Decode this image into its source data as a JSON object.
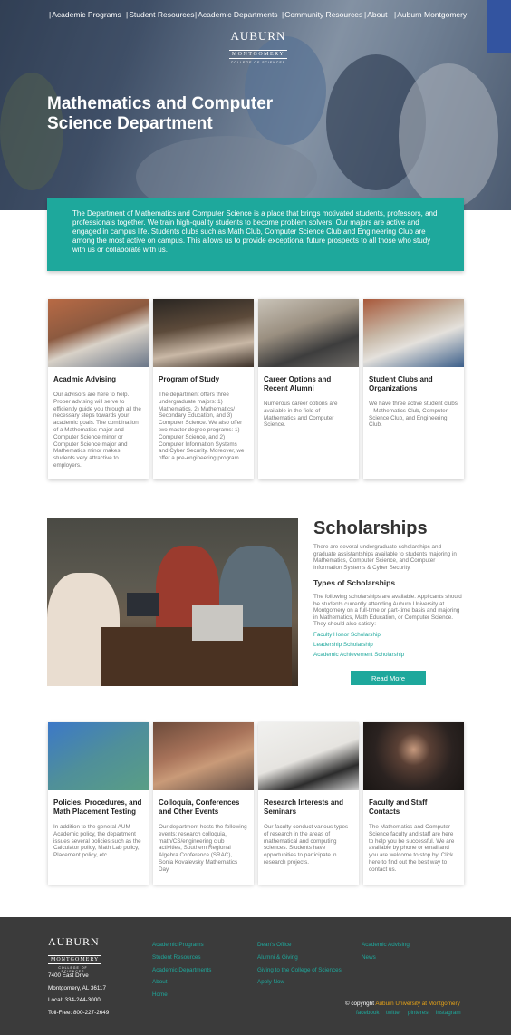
{
  "nav": [
    "Academic Programs",
    "Student Resources",
    "Academic Departments",
    "Community Resources",
    "About",
    "Auburn Montgomery"
  ],
  "logo": {
    "main": "AUBURN",
    "sub": "MONTGOMERY",
    "tag": "COLLEGE OF SCIENCES"
  },
  "hero": {
    "title": "Mathematics and Computer Science Department"
  },
  "intro": "The Department of Mathematics and Computer Science is a place that brings motivated students, professors, and professionals together.  We train high-quality students to become problem solvers.  Our majors are active and engaged in campus life.  Students clubs such as Math Club, Computer Science Club and Engineering Club are among the most active on campus.  This allows us to provide exceptional future prospects to all those who study with us or collaborate with us.",
  "cards_top": [
    {
      "title": "Acadmic Advising",
      "text": "Our advisors are here to help. Proper advising will serve to efficiently guide you through all the necessary steps towards your academic goals. The combination of a Mathematics major and Computer Science minor or Computer Science major and Mathematics minor makes students very attractive to employers."
    },
    {
      "title": "Program of Study",
      "text": "The department offers three undergraduate majors: 1) Mathematics, 2) Mathematics/ Secondary Education, and 3) Computer Science. We also offer two master degree programs: 1) Computer Science, and 2) Computer Information Systems and Cyber Security. Moreover, we offer a pre-engineering program."
    },
    {
      "title": "Career Options and Recent Alumni",
      "text": "Numerous career options are available in the field of Mathematics and Computer Science."
    },
    {
      "title": "Student Clubs and Organizations",
      "text": "We have three active student clubs – Mathematics Club, Computer Science Club, and Engineering Club."
    }
  ],
  "scholarships": {
    "title": "Scholarships",
    "intro": "There are several undergraduate scholarships and graduate assistantships available to students majoring in Mathematics, Computer Science, and Computer Information Systems & Cyber Security.",
    "types_heading": "Types of Scholarships",
    "types_text": "The following scholarships are available. Applicants should be students currently attending Auburn University at Montgomery on a full-time or part-time basis and majoring in Mathematics, Math Education, or Computer Science. They should also satisfy:",
    "links": [
      "Faculty Honor Scholarship",
      "Leadership Scholarship",
      "Academic Achievement Scholarship"
    ],
    "button": "Read More"
  },
  "cards_bottom": [
    {
      "title": "Policies, Procedures, and Math Placement Testing",
      "text": "In addition to the general AUM Academic policy, the department issues several policies such as the Calculator policy, Math Lab policy, Placement policy, etc."
    },
    {
      "title": "Colloquia, Conferences and Other Events",
      "text": "Our department hosts the following events: research colloquia, math/CS/engineering club activities, Southern Regional Algebra Conference (SRAC), Sonia Kovalevsky Mathematics Day."
    },
    {
      "title": "Research Interests and Seminars",
      "text": "Our faculty conduct various types of research in the areas of mathematical and computing sciences.  Students have opportunities to participate in research projects."
    },
    {
      "title": "Faculty and Staff Contacts",
      "text": "The Mathematics and Computer Science faculty and staff are here to help you be successful.  We are available by phone or email and you are welcome to stop by. Click here to find out the best way to contact us."
    }
  ],
  "footer": {
    "address": [
      "7400 East Drive",
      "Montgomery, AL 36117",
      "Local: 334-244-3000",
      "Toll-Free: 800-227-2649"
    ],
    "col1": [
      "Academic Programs",
      "Student Resources",
      "Academic Departments",
      "About",
      "Home"
    ],
    "col2": [
      "Dean's Office",
      "Alumni & Giving",
      "Giving to the College of Sciences",
      "Apply Now"
    ],
    "col3": [
      "Academic Advising",
      "News"
    ],
    "copyright_prefix": "© copyright",
    "copyright_org": "Auburn University at Montgomery",
    "social": [
      "facebook",
      "twitter",
      "pinterest",
      "instagram"
    ]
  },
  "colors": {
    "accent": "#1ea89c",
    "footer_bg": "#3b3b3b",
    "copyright_org": "#e8a317"
  }
}
